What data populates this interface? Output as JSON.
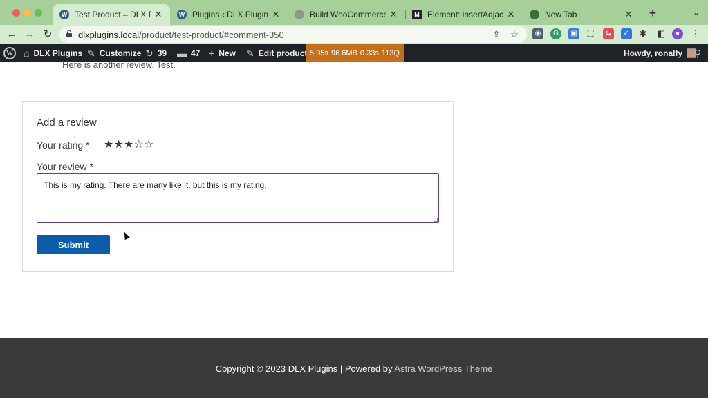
{
  "browser": {
    "tabs": [
      {
        "title": "Test Product – DLX Plugins",
        "favicon": "wordpress-icon",
        "active": true
      },
      {
        "title": "Plugins ‹ DLX Plugins — W",
        "favicon": "wordpress-icon",
        "active": false
      },
      {
        "title": "Build WooCommerce Rati",
        "favicon": "globe-icon",
        "active": false
      },
      {
        "title": "Element: insertAdjacentHT",
        "favicon": "mdn-icon",
        "active": false
      },
      {
        "title": "New Tab",
        "favicon": "chrome-icon",
        "active": false
      }
    ],
    "mdn_glyph": "M",
    "close_glyph": "✕",
    "new_tab_glyph": "+",
    "url_host": "dlxplugins.local",
    "url_path": "/product/test-product/#comment-350"
  },
  "adminbar": {
    "site_name": "DLX Plugins",
    "customize": "Customize",
    "updates_count": "39",
    "comments_count": "47",
    "new_label": "New",
    "edit_label": "Edit product",
    "perf_time": "5.95s",
    "perf_memory": "96.6MB",
    "perf_query_time": "0.33s",
    "perf_queries": "113Q",
    "howdy": "Howdy, ronalfy",
    "accent_color": "#c4701a"
  },
  "content": {
    "previous_review_text": "Here is another review. Test.",
    "form": {
      "title": "Add a review",
      "rating_label": "Your rating *",
      "rating_value": 3,
      "rating_max": 5,
      "review_label": "Your review *",
      "review_value": "This is my rating. There are many like it, but this is my rating.",
      "submit_label": "Submit",
      "submit_color": "#0d5cab"
    }
  },
  "footer": {
    "copyright": "Copyright © 2023 DLX Plugins | Powered by",
    "theme_link": "Astra WordPress Theme"
  }
}
